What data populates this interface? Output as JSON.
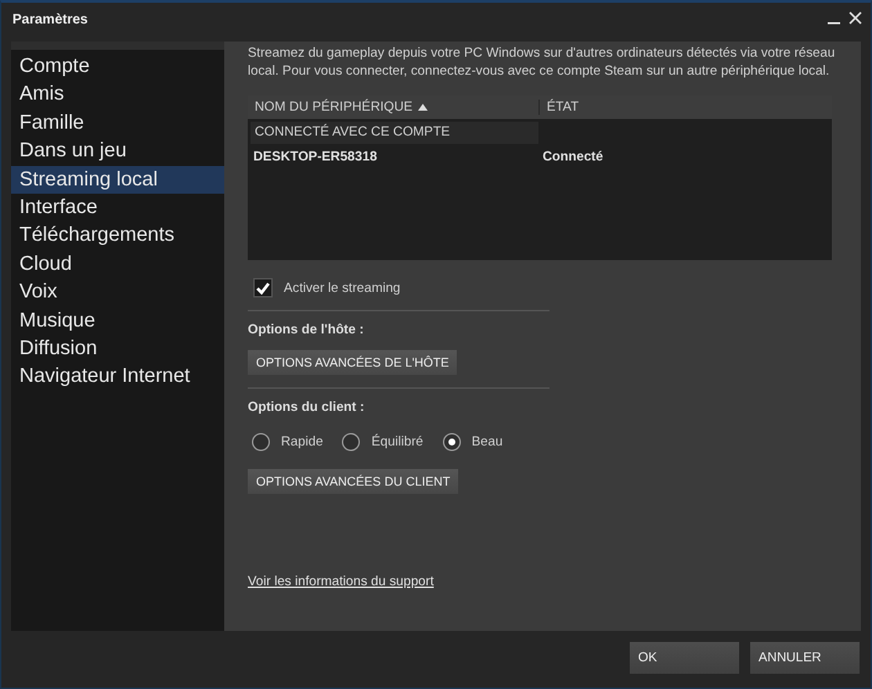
{
  "window": {
    "title": "Paramètres"
  },
  "sidebar": {
    "items": [
      {
        "label": "Compte",
        "selected": false
      },
      {
        "label": "Amis",
        "selected": false
      },
      {
        "label": "Famille",
        "selected": false
      },
      {
        "label": "Dans un jeu",
        "selected": false
      },
      {
        "label": "Streaming local",
        "selected": true
      },
      {
        "label": "Interface",
        "selected": false
      },
      {
        "label": "Téléchargements",
        "selected": false
      },
      {
        "label": "Cloud",
        "selected": false
      },
      {
        "label": "Voix",
        "selected": false
      },
      {
        "label": "Musique",
        "selected": false
      },
      {
        "label": "Diffusion",
        "selected": false
      },
      {
        "label": "Navigateur Internet",
        "selected": false
      }
    ]
  },
  "panel": {
    "description": "Streamez du gameplay depuis votre PC Windows sur d'autres ordinateurs détectés via votre réseau local. Pour vous connecter, connectez-vous avec ce compte Steam sur un autre périphérique local.",
    "table": {
      "columns": [
        {
          "label": "NOM DU PÉRIPHÉRIQUE",
          "sorted": true
        },
        {
          "label": "ÉTAT",
          "sorted": false
        }
      ],
      "groups": [
        {
          "label": "CONNECTÉ AVEC CE COMPTE",
          "rows": [
            {
              "device": "DESKTOP-ER58318",
              "status": "Connecté"
            }
          ]
        }
      ]
    },
    "streaming": {
      "label": "Activer le streaming",
      "checked": true
    },
    "host": {
      "label": "Options de l'hôte :",
      "button": "OPTIONS AVANCÉES DE L'HÔTE"
    },
    "client": {
      "label": "Options du client :",
      "options": [
        {
          "label": "Rapide",
          "selected": false
        },
        {
          "label": "Équilibré",
          "selected": false
        },
        {
          "label": "Beau",
          "selected": true
        }
      ],
      "button": "OPTIONS AVANCÉES DU CLIENT"
    },
    "support_link": "Voir les informations du support"
  },
  "buttons": [
    {
      "label": "OK"
    },
    {
      "label": "ANNULER"
    }
  ]
}
